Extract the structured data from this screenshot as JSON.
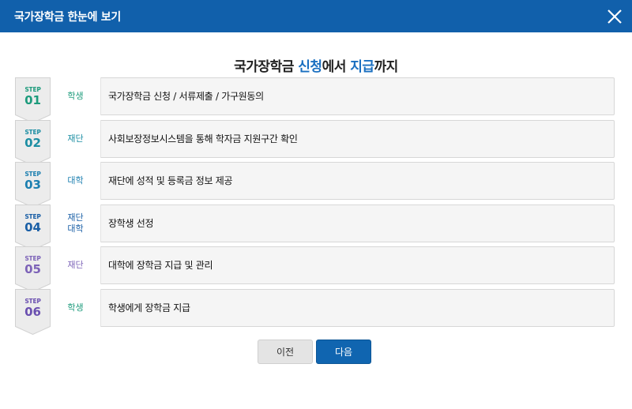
{
  "header": {
    "title": "국가장학금 한눈에 보기",
    "close_icon": "close-icon"
  },
  "main": {
    "title_parts": [
      "국가장학금 ",
      "신청",
      "에서 ",
      "지급",
      "까지"
    ]
  },
  "steps": [
    {
      "label": "STEP",
      "num": "01",
      "who": [
        "학생"
      ],
      "desc": "국가장학금 신청 / 서류제출 / 가구원동의",
      "color": "#1d9b7c"
    },
    {
      "label": "STEP",
      "num": "02",
      "who": [
        "재단"
      ],
      "desc": "사회보장정보시스템을 통해 학자금 지원구간 확인",
      "color": "#1c8ea3"
    },
    {
      "label": "STEP",
      "num": "03",
      "who": [
        "대학"
      ],
      "desc": "재단에 성적 및 등록금 정보 제공",
      "color": "#1c7fb0"
    },
    {
      "label": "STEP",
      "num": "04",
      "who": [
        "재단",
        "대학"
      ],
      "desc": "장학생 선정",
      "color": "#1a5fa6"
    },
    {
      "label": "STEP",
      "num": "05",
      "who": [
        "재단"
      ],
      "desc": "대학에 장학금 지급 및 관리",
      "color": "#7d63b8"
    },
    {
      "label": "STEP",
      "num": "06",
      "who": [
        "학생"
      ],
      "desc": "학생에게 장학금 지급",
      "color": "#6a4fb0"
    }
  ],
  "buttons": {
    "prev": "이전",
    "next": "다음"
  },
  "colors": {
    "header_bg": "#1160ab",
    "accent": "#1a6fc0",
    "next_btn": "#1065b0"
  }
}
